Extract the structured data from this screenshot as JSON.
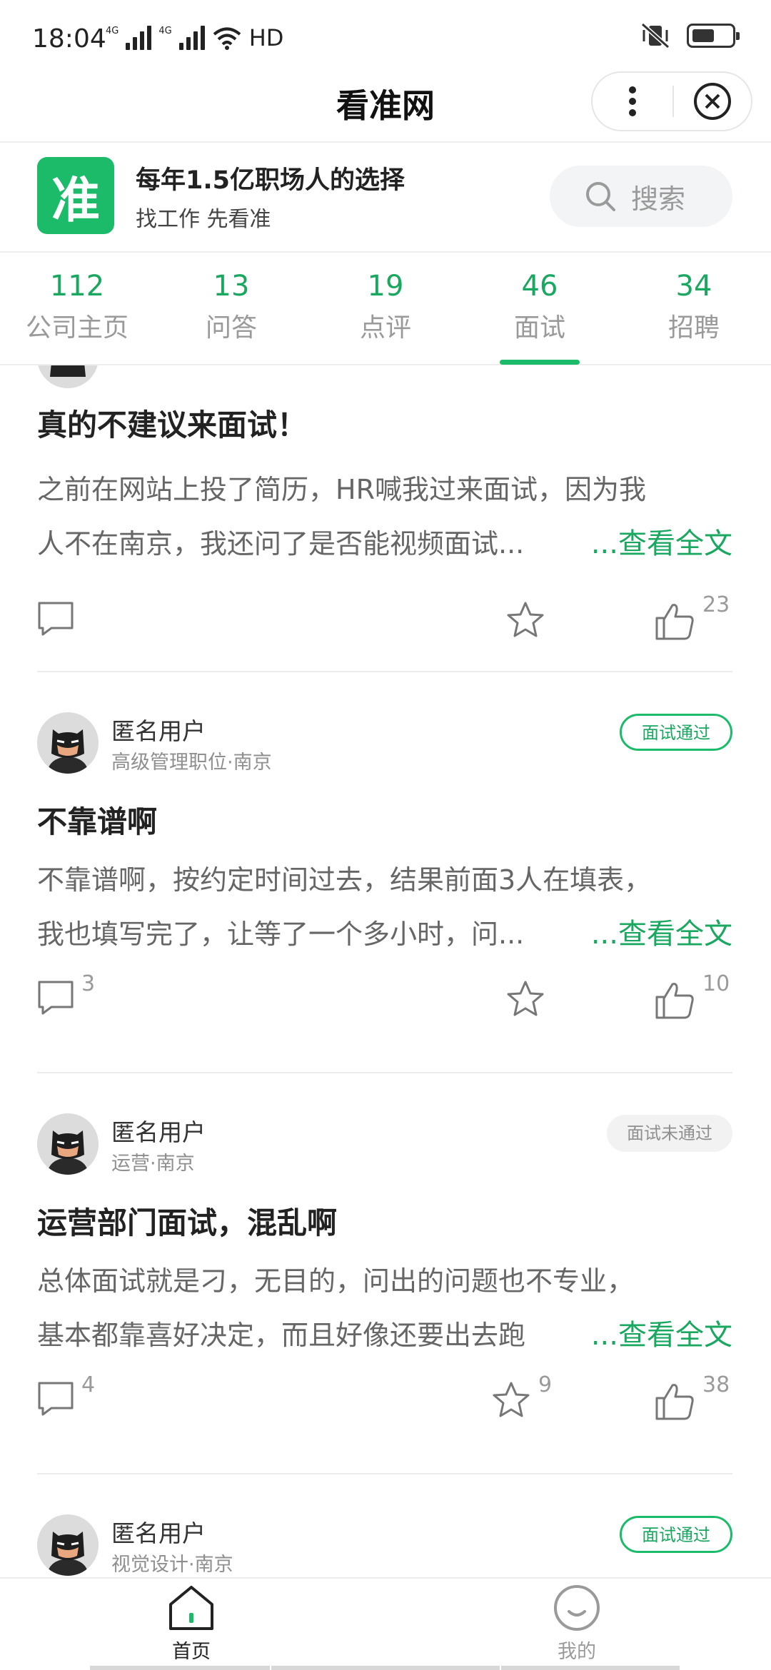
{
  "status_bar": {
    "time": "18:04",
    "network_1": "4G",
    "network_2": "4G",
    "hd": "HD",
    "icons": [
      "signal-icon",
      "wifi-icon",
      "vibrate-mute-icon",
      "battery-icon"
    ]
  },
  "title_bar": {
    "title": "看准网",
    "more_icon": "more-vertical-icon",
    "close_icon": "close-circle-icon"
  },
  "brand": {
    "logo_text": "准",
    "slogan": "每年1.5亿职场人的选择",
    "subslogan": "找工作 先看准",
    "search_placeholder": "搜索",
    "accent_color": "#1bbb6a"
  },
  "tabs": [
    {
      "count": "112",
      "label": "公司主页",
      "active": false
    },
    {
      "count": "13",
      "label": "问答",
      "active": false
    },
    {
      "count": "19",
      "label": "点评",
      "active": false
    },
    {
      "count": "46",
      "label": "面试",
      "active": true
    },
    {
      "count": "34",
      "label": "招聘",
      "active": false
    }
  ],
  "posts": [
    {
      "title": "真的不建议来面试！",
      "body_line1": "之前在网站上投了简历，HR喊我过来面试，因为我",
      "body_line2": "人不在南京，我还问了是否能视频面试...",
      "read_more": "...查看全文",
      "comments": "",
      "stars": "",
      "likes": "23"
    },
    {
      "user_name": "匿名用户",
      "user_meta": "高级管理职位·南京",
      "badge": "面试通过",
      "title": "不靠谱啊",
      "body_line1": "不靠谱啊，按约定时间过去，结果前面3人在填表，",
      "body_line2": "我也填写完了，让等了一个多小时，问...",
      "read_more": "...查看全文",
      "comments": "3",
      "stars": "",
      "likes": "10"
    },
    {
      "user_name": "匿名用户",
      "user_meta": "运营·南京",
      "badge": "面试未通过",
      "title": "运营部门面试，混乱啊",
      "body_line1": "总体面试就是刁，无目的，问出的问题也不专业，",
      "body_line2": "基本都靠喜好决定，而且好像还要出去跑",
      "read_more": "...查看全文",
      "comments": "4",
      "stars": "9",
      "likes": "38"
    },
    {
      "user_name": "匿名用户",
      "user_meta": "视觉设计·南京",
      "badge": "面试通过"
    }
  ],
  "bottom_nav": [
    {
      "label": "首页",
      "icon": "home-icon",
      "active": true
    },
    {
      "label": "我的",
      "icon": "smiley-profile-icon",
      "active": false
    }
  ]
}
